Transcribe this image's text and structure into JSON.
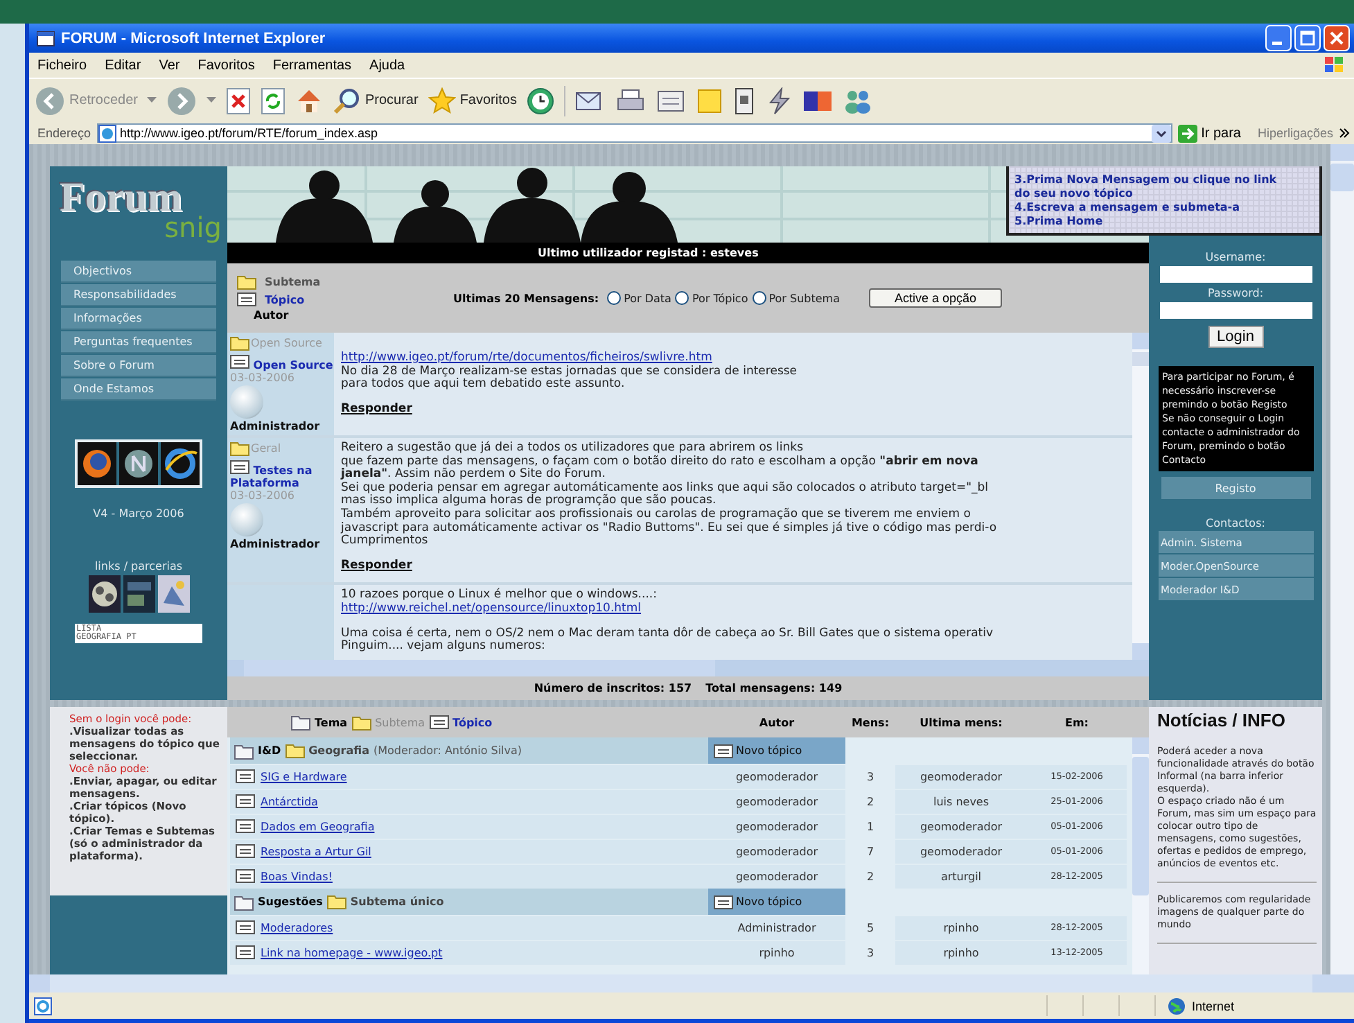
{
  "window": {
    "title": "FORUM - Microsoft Internet Explorer"
  },
  "menu": [
    "Ficheiro",
    "Editar",
    "Ver",
    "Favoritos",
    "Ferramentas",
    "Ajuda"
  ],
  "toolbar": {
    "back": "Retroceder",
    "search": "Procurar",
    "favorites": "Favoritos"
  },
  "address": {
    "label": "Endereço",
    "url": "http://www.igeo.pt/forum/RTE/forum_index.asp",
    "go": "Ir para",
    "links": "Hiperligações"
  },
  "sidebar": {
    "logo": "Forum",
    "logo_sub": "snig",
    "nav": [
      "Objectivos",
      "Responsabilidades",
      "Informações",
      "Perguntas frequentes",
      "Sobre o Forum",
      "Onde Estamos"
    ],
    "version": "V4 - Março 2006",
    "links_title": "links / parcerias",
    "banner": [
      "LISTA",
      "GEOGRAFIA PT"
    ]
  },
  "header": {
    "last_user": "Ultimo utilizador registad : esteves",
    "help_lines": [
      "3.Prima Nova Mensagem ou clique no link",
      "do seu novo tópico",
      "4.Escreva a mensagem e submeta-a",
      "5.Prima Home"
    ]
  },
  "legend": {
    "subtheme": "Subtema",
    "topic": "Tópico",
    "author": "Autor"
  },
  "latest": {
    "label": "Ultimas 20 Mensagens:",
    "options": [
      {
        "label": "Por Data",
        "selected": false
      },
      {
        "label": "Por Tópico",
        "selected": false
      },
      {
        "label": "Por Subtema",
        "selected": false
      }
    ],
    "button": "Active a opção"
  },
  "messages": [
    {
      "meta": {
        "subtheme": "Open Source",
        "topic": "Open Source",
        "date": "03-03-2006",
        "author": "Administrador"
      },
      "paragraphs": [
        [
          {
            "kind": "link",
            "text": "http://www.igeo.pt/forum/rte/documentos/ficheiros/swlivre.htm"
          },
          {
            "kind": "text",
            "text": "No dia 28 de Março realizam-se estas jornadas que se considera de interesse"
          },
          {
            "kind": "text",
            "text": "para todos que aqui tem debatido este assunto."
          }
        ]
      ],
      "reply": "Responder"
    },
    {
      "meta": {
        "subtheme": "Geral",
        "topic": "Testes na Plataforma",
        "date": "03-03-2006",
        "author": "Administrador"
      },
      "paragraphs": [
        [
          {
            "kind": "text",
            "text": "Reitero a sugestão que já dei a todos os utilizadores que para abrirem os links"
          },
          {
            "kind": "text",
            "text": "que fazem parte das mensagens, o façam com o botão direito do rato e escolham a opção **\"abrir em nova**"
          },
          {
            "kind": "text",
            "text": "**janela\"**. Assim não perdem o Site do Forum."
          },
          {
            "kind": "text",
            "text": "Sei que poderia pensar em agregar automáticamente aos links que aqui são colocados o atributo target=\"_bl"
          },
          {
            "kind": "text",
            "text": "mas isso implica alguma horas de programção que são poucas."
          },
          {
            "kind": "text",
            "text": "Também aproveito para solicitar aos profissionais ou carolas de programação que se tiverem me enviem o"
          },
          {
            "kind": "text",
            "text": "javascript para automáticamente activar os \"Radio Buttoms\". Eu sei que é simples já tive o código mas perdi-o"
          },
          {
            "kind": "text",
            "text": "Cumprimentos"
          }
        ]
      ],
      "reply": "Responder"
    },
    {
      "paragraphs": [
        [
          {
            "kind": "text",
            "text": "10 razoes porque o Linux é melhor que o windows....:"
          },
          {
            "kind": "link",
            "text": "http://www.reichel.net/opensource/linuxtop10.html"
          }
        ],
        [
          {
            "kind": "text",
            "text": "Uma coisa é certa, nem o OS/2 nem o Mac deram tanta dôr de cabeça ao Sr. Bill Gates que o sistema operativ"
          },
          {
            "kind": "text",
            "text": "Pinguim.... vejam alguns numeros:"
          }
        ]
      ]
    }
  ],
  "stats": [
    "Número de inscritos: 157",
    "Total mensagens: 149"
  ],
  "login": {
    "username_label": "Username:",
    "password_label": "Password:",
    "button": "Login",
    "notice": [
      "Para participar no Forum, é necessário inscrever-se premindo o botão Registo",
      "Se não conseguir o Login contacte o administrador do Forum, premindo o botão Contacto"
    ],
    "register": "Registo",
    "contacts_title": "Contactos:",
    "contacts": [
      "Admin. Sistema",
      "Moder.OpenSource",
      "Moderador I&D"
    ]
  },
  "guest": {
    "can_title": "Sem o login você pode:",
    "can": ".Visualizar todas as mensagens do tópico que seleccionar.",
    "cannot_title": "Você não pode:",
    "cannot": [
      ".Enviar, apagar, ou editar mensagens.",
      ".Criar tópicos (Novo tópico).",
      ".Criar Temas e Subtemas (só o administrador da plataforma)."
    ]
  },
  "forum_table": {
    "legend": {
      "theme": "Tema",
      "subtheme": "Subtema",
      "topic": "Tópico"
    },
    "columns": [
      "Autor",
      "Mens:",
      "Ultima mens:",
      "Em:"
    ],
    "groups": [
      {
        "theme": "I&D",
        "subtheme": "Geografia",
        "moderator": "(Moderador: António Silva)",
        "new_topic": "Novo tópico",
        "rows": [
          {
            "title": "SIG e Hardware",
            "author": "geomoderador",
            "count": "3",
            "last": "geomoderador",
            "date": "15-02-2006"
          },
          {
            "title": "Antárctida",
            "author": "geomoderador",
            "count": "2",
            "last": "luis neves",
            "date": "25-01-2006"
          },
          {
            "title": "Dados em Geografia",
            "author": "geomoderador",
            "count": "1",
            "last": "geomoderador",
            "date": "05-01-2006"
          },
          {
            "title": "Resposta a Artur Gil",
            "author": "geomoderador",
            "count": "7",
            "last": "geomoderador",
            "date": "05-01-2006"
          },
          {
            "title": "Boas Vindas!",
            "author": "geomoderador",
            "count": "2",
            "last": "arturgil",
            "date": "28-12-2005"
          }
        ]
      },
      {
        "theme": "Sugestões",
        "subtheme": "Subtema único",
        "new_topic": "Novo tópico",
        "rows": [
          {
            "title": "Moderadores",
            "author": "Administrador",
            "count": "5",
            "last": "rpinho",
            "date": "28-12-2005"
          },
          {
            "title": "Link na homepage - www.igeo.pt",
            "author": "rpinho",
            "count": "3",
            "last": "rpinho",
            "date": "13-12-2005"
          }
        ]
      }
    ]
  },
  "news": {
    "title": "Notícias / INFO",
    "blocks": [
      [
        "Poderá aceder a nova funcionalidade através do botão Informal (na barra inferior esquerda).",
        "O espaço criado não é um Forum, mas sim um espaço para colocar outro tipo de mensagens, como sugestões, ofertas e pedidos de emprego, anúncios de eventos etc."
      ],
      [
        "Publicaremos com regularidade imagens de qualquer parte do mundo"
      ]
    ]
  },
  "status_bar": {
    "zone": "Internet"
  }
}
